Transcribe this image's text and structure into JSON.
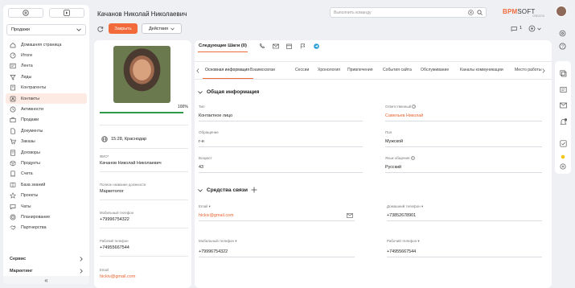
{
  "header": {
    "title": "Качанов Николай Николаевич",
    "search_placeholder": "Выполнить команду",
    "logo_main": "BPM",
    "logo_soft": "SOFT",
    "logo_sub": "CREATIO"
  },
  "toolbar": {
    "close_label": "Закрыть",
    "actions_label": "Действия",
    "likes": "1"
  },
  "sidebar": {
    "workplace": "Продажи",
    "items": [
      {
        "label": "Домашняя страница",
        "icon": "home-icon"
      },
      {
        "label": "Итоги",
        "icon": "gauge-icon"
      },
      {
        "label": "Лента",
        "icon": "feed-icon"
      },
      {
        "label": "Лиды",
        "icon": "lead-icon"
      },
      {
        "label": "Контрагенты",
        "icon": "building-icon"
      },
      {
        "label": "Контакты",
        "icon": "contact-icon",
        "active": true
      },
      {
        "label": "Активности",
        "icon": "clock-icon"
      },
      {
        "label": "Продажи",
        "icon": "briefcase-icon"
      },
      {
        "label": "Документы",
        "icon": "document-icon"
      },
      {
        "label": "Заказы",
        "icon": "cart-icon"
      },
      {
        "label": "Договоры",
        "icon": "contract-icon"
      },
      {
        "label": "Продукты",
        "icon": "box-icon"
      },
      {
        "label": "Счета",
        "icon": "invoice-icon"
      },
      {
        "label": "База знаний",
        "icon": "book-icon"
      },
      {
        "label": "Проекты",
        "icon": "star-icon"
      },
      {
        "label": "Чаты",
        "icon": "chat-icon"
      },
      {
        "label": "Планирование",
        "icon": "plan-icon"
      },
      {
        "label": "Партнерства",
        "icon": "handshake-icon"
      }
    ],
    "service": "Сервис",
    "marketing": "Маркетинг"
  },
  "profile": {
    "completeness": "100%",
    "completeness_value": 1.0,
    "timezone": "15:28, Краснодар",
    "fio_label": "ФИО*",
    "fio": "Качанов Николай Николаевич",
    "position_label": "Полное название должности",
    "position": "Маркетолог",
    "mobile_label": "Мобильный телефон",
    "mobile": "+79996754322",
    "work_label": "Рабочий телефон",
    "work": "+74955667544",
    "email_label": "Email",
    "email": "hickiv@gmail.com"
  },
  "main": {
    "next_steps": "Следующие Шаги (0)",
    "tabs": [
      "Основная информация",
      "Взаимосвязи",
      "Сессии",
      "Хронология",
      "Привлечения",
      "События сайта",
      "Обслуживание",
      "Каналы коммуникации",
      "Место работы"
    ],
    "general": {
      "title": "Общая информация",
      "type_label": "Тип",
      "type": "Контактное лицо",
      "resp_label": "Ответственный",
      "resp": "Савельев Николай",
      "address_label": "Обращение",
      "address": "г-н",
      "gender_label": "Пол",
      "gender": "Мужской",
      "age_label": "Возраст",
      "age": "43",
      "lang_label": "Язык общения",
      "lang": "Русский"
    },
    "comm": {
      "title": "Средства связи",
      "email_label": "Email",
      "email": "hickiv@gmail.com",
      "home_label": "Домашний телефон",
      "home": "+73852678901",
      "mobile_label": "Мобильный телефон",
      "mobile": "+79996754322",
      "work_label": "Рабочий телефон",
      "work": "+74955667544"
    }
  },
  "colors": {
    "accent": "#f2693a",
    "link": "#e8642f",
    "progress": "#2d9a4a"
  }
}
